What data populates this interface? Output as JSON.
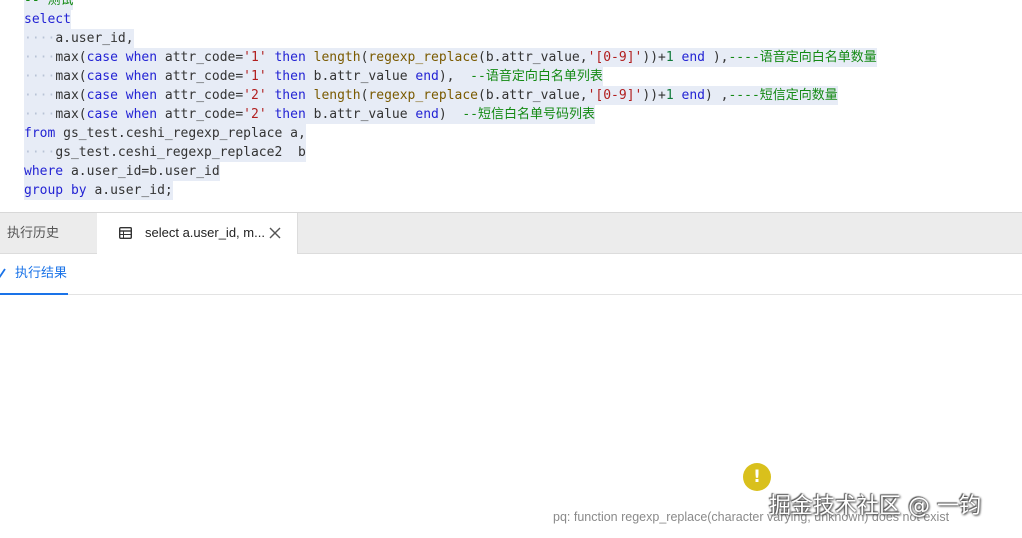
{
  "editor": {
    "lines": [
      [
        {
          "t": "-- 测试",
          "c": "cmt"
        }
      ],
      [
        {
          "t": "select",
          "c": "kw"
        }
      ],
      [
        {
          "t": "a.user_id,",
          "c": "plain"
        }
      ],
      [
        {
          "t": "max(",
          "c": "plain"
        },
        {
          "t": "case",
          "c": "kw"
        },
        {
          "t": " ",
          "c": "plain"
        },
        {
          "t": "when",
          "c": "kw"
        },
        {
          "t": " attr_code=",
          "c": "plain"
        },
        {
          "t": "'1'",
          "c": "str"
        },
        {
          "t": " ",
          "c": "plain"
        },
        {
          "t": "then",
          "c": "kw"
        },
        {
          "t": " ",
          "c": "plain"
        },
        {
          "t": "length",
          "c": "fn"
        },
        {
          "t": "(",
          "c": "plain"
        },
        {
          "t": "regexp_replace",
          "c": "fn"
        },
        {
          "t": "(b.attr_value,",
          "c": "plain"
        },
        {
          "t": "'[0-9]'",
          "c": "str"
        },
        {
          "t": "))+",
          "c": "plain"
        },
        {
          "t": "1",
          "c": "num"
        },
        {
          "t": " ",
          "c": "plain"
        },
        {
          "t": "end",
          "c": "kw"
        },
        {
          "t": " ),",
          "c": "plain"
        },
        {
          "t": "----语音定向白名单数量",
          "c": "cmt"
        }
      ],
      [
        {
          "t": "max(",
          "c": "plain"
        },
        {
          "t": "case",
          "c": "kw"
        },
        {
          "t": " ",
          "c": "plain"
        },
        {
          "t": "when",
          "c": "kw"
        },
        {
          "t": " attr_code=",
          "c": "plain"
        },
        {
          "t": "'1'",
          "c": "str"
        },
        {
          "t": " ",
          "c": "plain"
        },
        {
          "t": "then",
          "c": "kw"
        },
        {
          "t": " b.attr_value ",
          "c": "plain"
        },
        {
          "t": "end",
          "c": "kw"
        },
        {
          "t": "),  ",
          "c": "plain"
        },
        {
          "t": "--语音定向白名单列表",
          "c": "cmt"
        }
      ],
      [
        {
          "t": "max(",
          "c": "plain"
        },
        {
          "t": "case",
          "c": "kw"
        },
        {
          "t": " ",
          "c": "plain"
        },
        {
          "t": "when",
          "c": "kw"
        },
        {
          "t": " attr_code=",
          "c": "plain"
        },
        {
          "t": "'2'",
          "c": "str"
        },
        {
          "t": " ",
          "c": "plain"
        },
        {
          "t": "then",
          "c": "kw"
        },
        {
          "t": " ",
          "c": "plain"
        },
        {
          "t": "length",
          "c": "fn"
        },
        {
          "t": "(",
          "c": "plain"
        },
        {
          "t": "regexp_replace",
          "c": "fn"
        },
        {
          "t": "(b.attr_value,",
          "c": "plain"
        },
        {
          "t": "'[0-9]'",
          "c": "str"
        },
        {
          "t": "))+",
          "c": "plain"
        },
        {
          "t": "1",
          "c": "num"
        },
        {
          "t": " ",
          "c": "plain"
        },
        {
          "t": "end",
          "c": "kw"
        },
        {
          "t": ") ,",
          "c": "plain"
        },
        {
          "t": "----短信定向数量",
          "c": "cmt"
        }
      ],
      [
        {
          "t": "max(",
          "c": "plain"
        },
        {
          "t": "case",
          "c": "kw"
        },
        {
          "t": " ",
          "c": "plain"
        },
        {
          "t": "when",
          "c": "kw"
        },
        {
          "t": " attr_code=",
          "c": "plain"
        },
        {
          "t": "'2'",
          "c": "str"
        },
        {
          "t": " ",
          "c": "plain"
        },
        {
          "t": "then",
          "c": "kw"
        },
        {
          "t": " b.attr_value ",
          "c": "plain"
        },
        {
          "t": "end",
          "c": "kw"
        },
        {
          "t": ")  ",
          "c": "plain"
        },
        {
          "t": "--短信白名单号码列表",
          "c": "cmt"
        }
      ],
      [
        {
          "t": "from",
          "c": "kw"
        },
        {
          "t": " gs_test.ceshi_regexp_replace a,",
          "c": "plain"
        }
      ],
      [
        {
          "t": "gs_test.ceshi_regexp_replace2  b",
          "c": "plain"
        }
      ],
      [
        {
          "t": "where",
          "c": "kw"
        },
        {
          "t": " a.user_id=b.user_id",
          "c": "plain"
        }
      ],
      [
        {
          "t": "group",
          "c": "kw"
        },
        {
          "t": " ",
          "c": "plain"
        },
        {
          "t": "by",
          "c": "kw"
        },
        {
          "t": " a.user_id;",
          "c": "plain"
        }
      ]
    ],
    "indented_lines": [
      2,
      3,
      4,
      5,
      6,
      8
    ]
  },
  "tabs": {
    "history_label": "执行历史",
    "query_label": "select a.user_id, m...",
    "query_icon": "table-icon",
    "close_icon": "close-icon"
  },
  "results": {
    "tab_label": "执行结果",
    "tab_icon": "check-icon",
    "error_icon": "warning-icon",
    "error_message": "pq: function regexp_replace(character varying, unknown) does not exist",
    "watermark": "掘金技术社区 @ 一钧"
  },
  "colors": {
    "keyword": "#2323d4",
    "string": "#b11e1e",
    "comment": "#148a14",
    "accent": "#1a73e8",
    "warning": "#d9c01c"
  }
}
